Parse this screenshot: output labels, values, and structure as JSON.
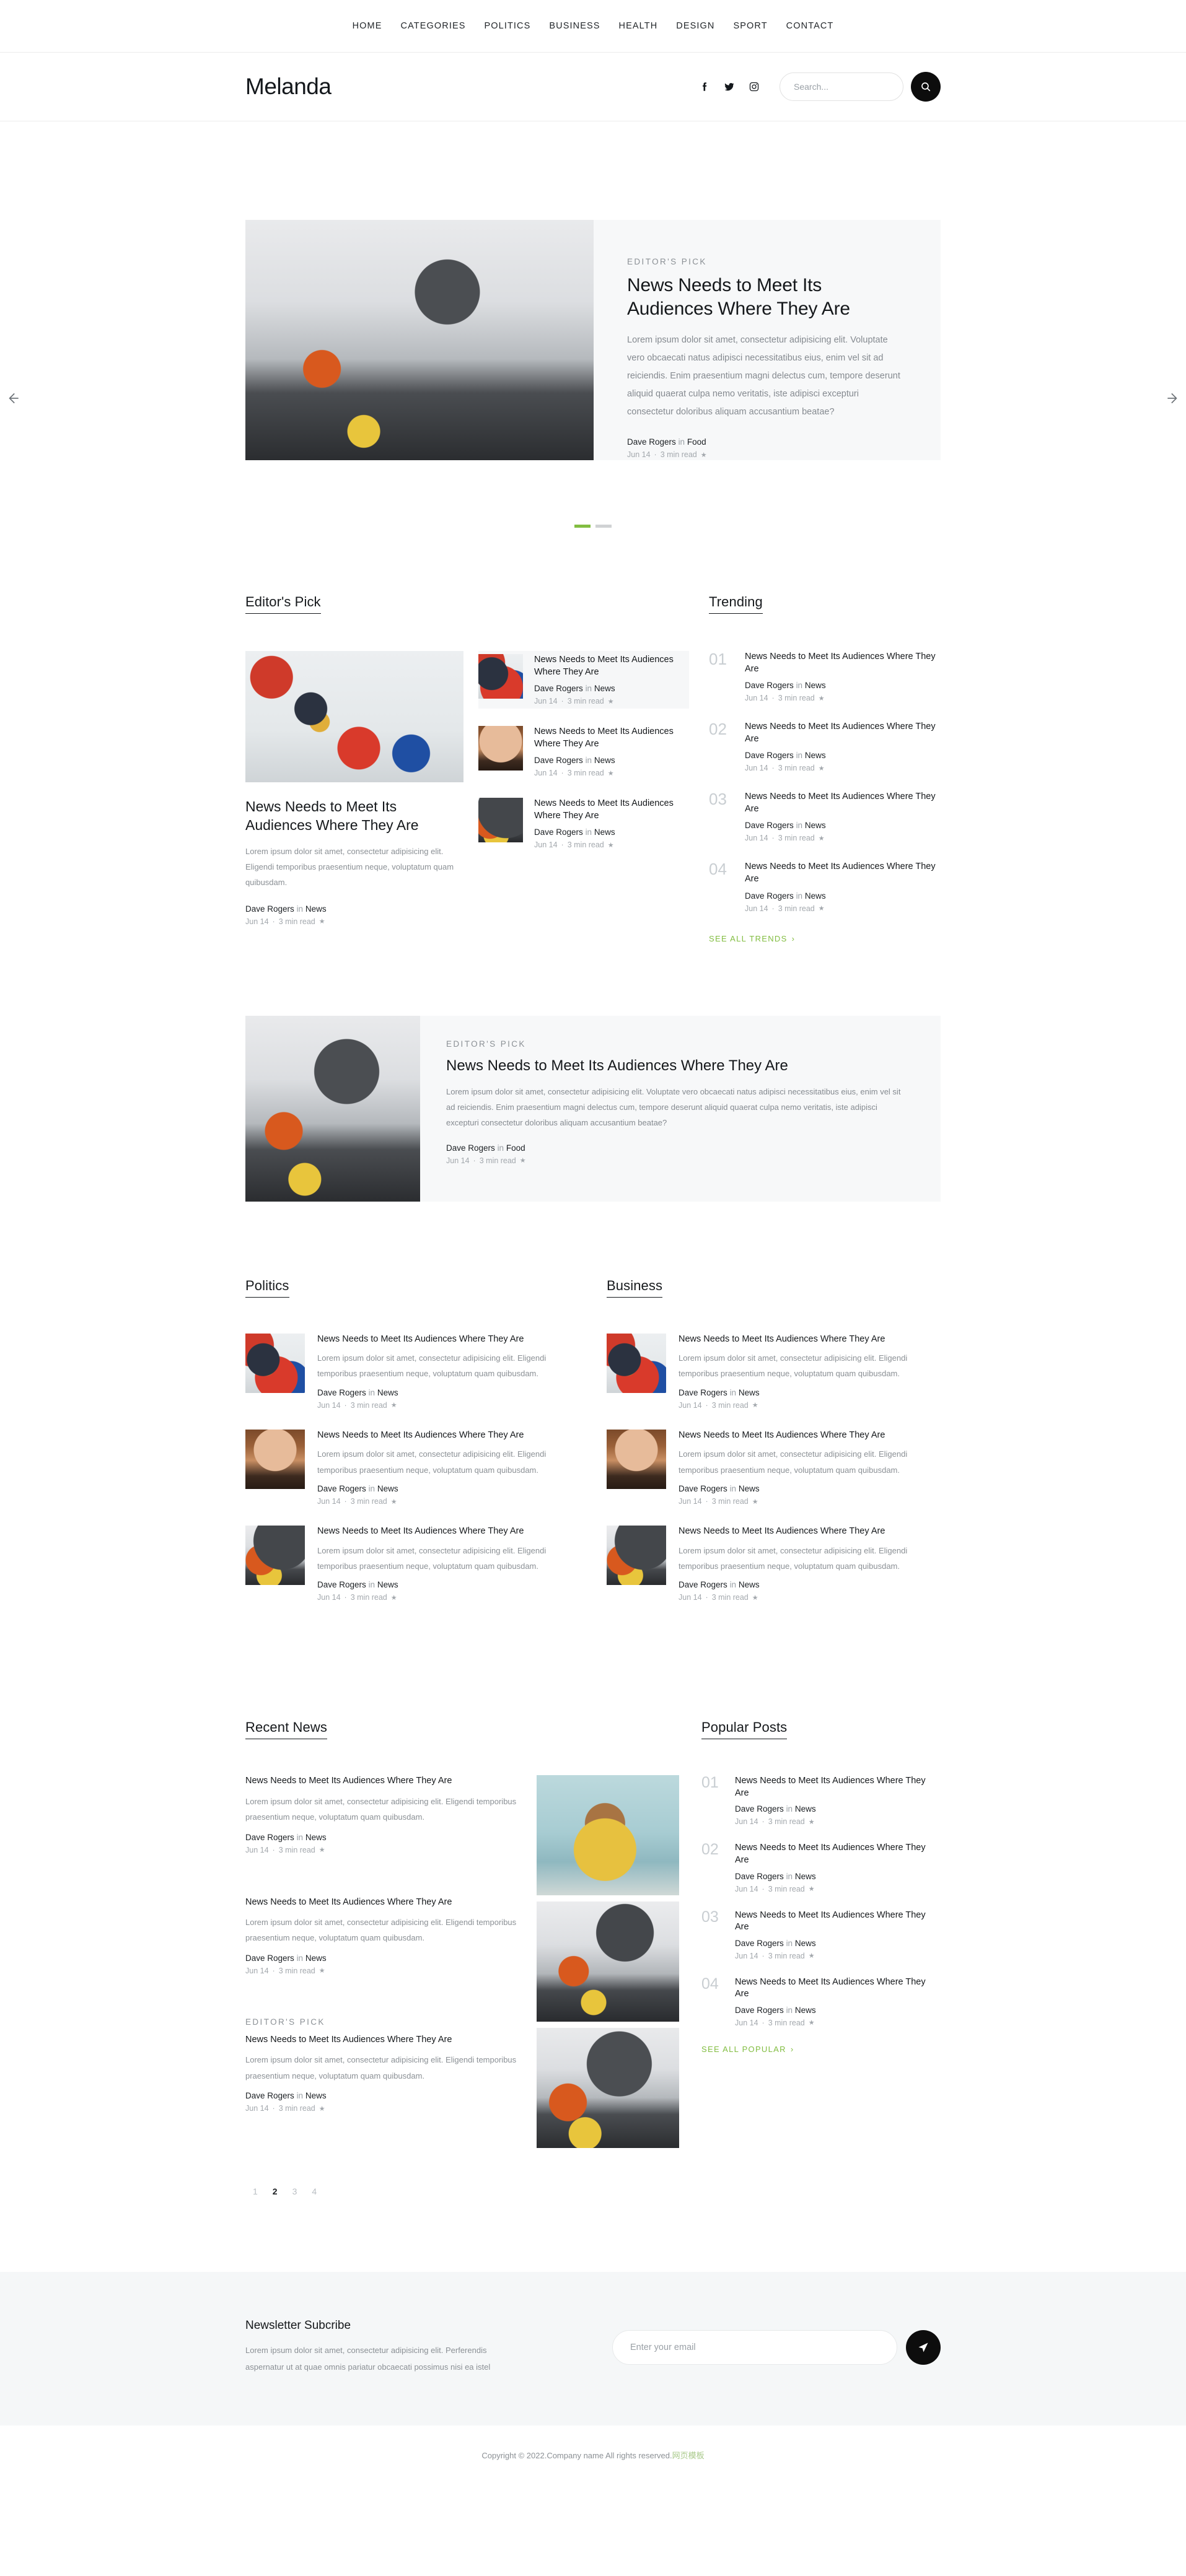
{
  "nav": {
    "items": [
      {
        "label": "HOME"
      },
      {
        "label": "CATEGORIES"
      },
      {
        "label": "POLITICS"
      },
      {
        "label": "BUSINESS"
      },
      {
        "label": "HEALTH"
      },
      {
        "label": "DESIGN"
      },
      {
        "label": "SPORT"
      },
      {
        "label": "CONTACT"
      }
    ]
  },
  "masthead": {
    "logo": "Melanda",
    "social": [
      "facebook-icon",
      "twitter-icon",
      "instagram-icon"
    ],
    "search_placeholder": "Search...",
    "search_value": "",
    "search_button_icon": "search-icon"
  },
  "hero": {
    "kicker": "EDITOR'S PICK",
    "title": "News Needs to Meet Its Audiences Where They Are",
    "excerpt": "Lorem ipsum dolor sit amet, consectetur adipisicing elit. Voluptate vero obcaecati natus adipisci necessitatibus eius, enim vel sit ad reiciendis. Enim praesentium magni delectus cum, tempore deserunt aliquid quaerat culpa nemo veritatis, iste adipisci excepturi consectetur doloribus aliquam accusantium beatae?",
    "author": "Dave Rogers",
    "in_word": "in",
    "category": "Food",
    "date": "Jun 14",
    "sep": "·",
    "read_time": "3 min read",
    "star": "★",
    "prev_icon": "arrow-left-icon",
    "next_icon": "arrow-right-icon",
    "dots": [
      {
        "active": true
      },
      {
        "active": false
      }
    ]
  },
  "editors_pick": {
    "title": "Editor's Pick",
    "feature": {
      "title": "News Needs to Meet Its Audiences Where They Are",
      "excerpt": "Lorem ipsum dolor sit amet, consectetur adipisicing elit. Eligendi temporibus praesentium neque, voluptatum quam quibusdam.",
      "author": "Dave Rogers",
      "in_word": "in",
      "category": "News",
      "date": "Jun 14",
      "sep": "·",
      "read_time": "3 min read",
      "star": "★"
    },
    "list": [
      {
        "title": "News Needs to Meet Its Audiences Where They Are",
        "author": "Dave Rogers",
        "in_word": "in",
        "category": "News",
        "date": "Jun 14",
        "sep": "·",
        "read_time": "3 min read",
        "star": "★",
        "highlighted": true,
        "thumb": "ph-gallery"
      },
      {
        "title": "News Needs to Meet Its Audiences Where They Are",
        "author": "Dave Rogers",
        "in_word": "in",
        "category": "News",
        "date": "Jun 14",
        "sep": "·",
        "read_time": "3 min read",
        "star": "★",
        "highlighted": false,
        "thumb": "ph-woman"
      },
      {
        "title": "News Needs to Meet Its Audiences Where They Are",
        "author": "Dave Rogers",
        "in_word": "in",
        "category": "News",
        "date": "Jun 14",
        "sep": "·",
        "read_time": "3 min read",
        "star": "★",
        "highlighted": false,
        "thumb": "ph-kitchen2"
      }
    ]
  },
  "trending": {
    "title": "Trending",
    "see_all": "SEE ALL TRENDS",
    "chevron": "›",
    "items": [
      {
        "num": "01",
        "title": "News Needs to Meet Its Audiences Where They Are",
        "author": "Dave Rogers",
        "in_word": "in",
        "category": "News",
        "date": "Jun 14",
        "sep": "·",
        "read_time": "3 min read",
        "star": "★"
      },
      {
        "num": "02",
        "title": "News Needs to Meet Its Audiences Where They Are",
        "author": "Dave Rogers",
        "in_word": "in",
        "category": "News",
        "date": "Jun 14",
        "sep": "·",
        "read_time": "3 min read",
        "star": "★"
      },
      {
        "num": "03",
        "title": "News Needs to Meet Its Audiences Where They Are",
        "author": "Dave Rogers",
        "in_word": "in",
        "category": "News",
        "date": "Jun 14",
        "sep": "·",
        "read_time": "3 min read",
        "star": "★"
      },
      {
        "num": "04",
        "title": "News Needs to Meet Its Audiences Where They Are",
        "author": "Dave Rogers",
        "in_word": "in",
        "category": "News",
        "date": "Jun 14",
        "sep": "·",
        "read_time": "3 min read",
        "star": "★"
      }
    ]
  },
  "hero2": {
    "kicker": "EDITOR'S PICK",
    "title": "News Needs to Meet Its Audiences Where They Are",
    "excerpt": "Lorem ipsum dolor sit amet, consectetur adipisicing elit. Voluptate vero obcaecati natus adipisci necessitatibus eius, enim vel sit ad reiciendis. Enim praesentium magni delectus cum, tempore deserunt aliquid quaerat culpa nemo veritatis, iste adipisci excepturi consectetur doloribus aliquam accusantium beatae?",
    "author": "Dave Rogers",
    "in_word": "in",
    "category": "Food",
    "date": "Jun 14",
    "sep": "·",
    "read_time": "3 min read",
    "star": "★"
  },
  "politics": {
    "title": "Politics",
    "items": [
      {
        "title": "News Needs to Meet Its Audiences Where They Are",
        "excerpt": "Lorem ipsum dolor sit amet, consectetur adipisicing elit. Eligendi temporibus praesentium neque, voluptatum quam quibusdam.",
        "author": "Dave Rogers",
        "in_word": "in",
        "category": "News",
        "date": "Jun 14",
        "sep": "·",
        "read_time": "3 min read",
        "star": "★",
        "thumb": "ph-gallery"
      },
      {
        "title": "News Needs to Meet Its Audiences Where They Are",
        "excerpt": "Lorem ipsum dolor sit amet, consectetur adipisicing elit. Eligendi temporibus praesentium neque, voluptatum quam quibusdam.",
        "author": "Dave Rogers",
        "in_word": "in",
        "category": "News",
        "date": "Jun 14",
        "sep": "·",
        "read_time": "3 min read",
        "star": "★",
        "thumb": "ph-woman"
      },
      {
        "title": "News Needs to Meet Its Audiences Where They Are",
        "excerpt": "Lorem ipsum dolor sit amet, consectetur adipisicing elit. Eligendi temporibus praesentium neque, voluptatum quam quibusdam.",
        "author": "Dave Rogers",
        "in_word": "in",
        "category": "News",
        "date": "Jun 14",
        "sep": "·",
        "read_time": "3 min read",
        "star": "★",
        "thumb": "ph-kitchen2"
      }
    ]
  },
  "business": {
    "title": "Business",
    "items": [
      {
        "title": "News Needs to Meet Its Audiences Where They Are",
        "excerpt": "Lorem ipsum dolor sit amet, consectetur adipisicing elit. Eligendi temporibus praesentium neque, voluptatum quam quibusdam.",
        "author": "Dave Rogers",
        "in_word": "in",
        "category": "News",
        "date": "Jun 14",
        "sep": "·",
        "read_time": "3 min read",
        "star": "★",
        "thumb": "ph-gallery"
      },
      {
        "title": "News Needs to Meet Its Audiences Where They Are",
        "excerpt": "Lorem ipsum dolor sit amet, consectetur adipisicing elit. Eligendi temporibus praesentium neque, voluptatum quam quibusdam.",
        "author": "Dave Rogers",
        "in_word": "in",
        "category": "News",
        "date": "Jun 14",
        "sep": "·",
        "read_time": "3 min read",
        "star": "★",
        "thumb": "ph-woman"
      },
      {
        "title": "News Needs to Meet Its Audiences Where They Are",
        "excerpt": "Lorem ipsum dolor sit amet, consectetur adipisicing elit. Eligendi temporibus praesentium neque, voluptatum quam quibusdam.",
        "author": "Dave Rogers",
        "in_word": "in",
        "category": "News",
        "date": "Jun 14",
        "sep": "·",
        "read_time": "3 min read",
        "star": "★",
        "thumb": "ph-kitchen2"
      }
    ]
  },
  "recent_news": {
    "title": "Recent News",
    "items": [
      {
        "kicker": "",
        "title": "News Needs to Meet Its Audiences Where They Are",
        "excerpt": "Lorem ipsum dolor sit amet, consectetur adipisicing elit. Eligendi temporibus praesentium neque, voluptatum quam quibusdam.",
        "author": "Dave Rogers",
        "in_word": "in",
        "category": "News",
        "date": "Jun 14",
        "sep": "·",
        "read_time": "3 min read",
        "star": "★"
      },
      {
        "kicker": "",
        "title": "News Needs to Meet Its Audiences Where They Are",
        "excerpt": "Lorem ipsum dolor sit amet, consectetur adipisicing elit. Eligendi temporibus praesentium neque, voluptatum quam quibusdam.",
        "author": "Dave Rogers",
        "in_word": "in",
        "category": "News",
        "date": "Jun 14",
        "sep": "·",
        "read_time": "3 min read",
        "star": "★"
      },
      {
        "kicker": "EDITOR'S PICK",
        "title": "News Needs to Meet Its Audiences Where They Are",
        "excerpt": "Lorem ipsum dolor sit amet, consectetur adipisicing elit. Eligendi temporibus praesentium neque, voluptatum quam quibusdam.",
        "author": "Dave Rogers",
        "in_word": "in",
        "category": "News",
        "date": "Jun 14",
        "sep": "·",
        "read_time": "3 min read",
        "star": "★"
      }
    ],
    "thumbs": [
      "ph-dog",
      "ph-kitchen2",
      "ph-kitchen"
    ],
    "pagination": [
      {
        "label": "1",
        "active": false
      },
      {
        "label": "2",
        "active": true
      },
      {
        "label": "3",
        "active": false
      },
      {
        "label": "4",
        "active": false
      }
    ]
  },
  "popular_posts": {
    "title": "Popular Posts",
    "see_all": "SEE ALL POPULAR",
    "chevron": "›",
    "items": [
      {
        "num": "01",
        "title": "News Needs to Meet Its Audiences Where They Are",
        "author": "Dave Rogers",
        "in_word": "in",
        "category": "News",
        "date": "Jun 14",
        "sep": "·",
        "read_time": "3 min read",
        "star": "★"
      },
      {
        "num": "02",
        "title": "News Needs to Meet Its Audiences Where They Are",
        "author": "Dave Rogers",
        "in_word": "in",
        "category": "News",
        "date": "Jun 14",
        "sep": "·",
        "read_time": "3 min read",
        "star": "★"
      },
      {
        "num": "03",
        "title": "News Needs to Meet Its Audiences Where They Are",
        "author": "Dave Rogers",
        "in_word": "in",
        "category": "News",
        "date": "Jun 14",
        "sep": "·",
        "read_time": "3 min read",
        "star": "★"
      },
      {
        "num": "04",
        "title": "News Needs to Meet Its Audiences Where They Are",
        "author": "Dave Rogers",
        "in_word": "in",
        "category": "News",
        "date": "Jun 14",
        "sep": "·",
        "read_time": "3 min read",
        "star": "★"
      }
    ]
  },
  "newsletter": {
    "title": "Newsletter Subcribe",
    "text": "Lorem ipsum dolor sit amet, consectetur adipisicing elit. Perferendis aspernatur ut at quae omnis pariatur obcaecati possimus nisi ea istel",
    "placeholder": "Enter your email",
    "value": "",
    "send_icon": "send-icon"
  },
  "footer": {
    "copyright": "Copyright © 2022.Company name All rights reserved.",
    "cn_link": "网页模板"
  },
  "colors": {
    "accent_green": "#82bd41",
    "dark": "#0d0d0d",
    "panel": "#f7f8f9",
    "muted": "#8b9095"
  }
}
